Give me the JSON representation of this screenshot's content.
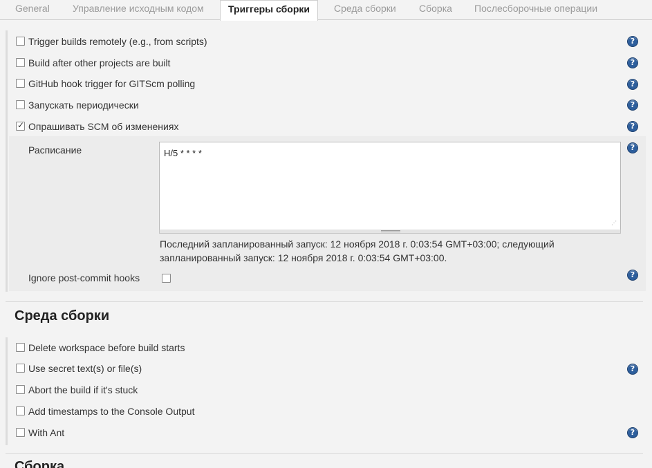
{
  "tabs": [
    {
      "label": "General",
      "active": false
    },
    {
      "label": "Управление исходным кодом",
      "active": false
    },
    {
      "label": "Триггеры сборки",
      "active": true
    },
    {
      "label": "Среда сборки",
      "active": false
    },
    {
      "label": "Сборка",
      "active": false
    },
    {
      "label": "Послесборочные операции",
      "active": false
    }
  ],
  "triggers": {
    "items": [
      {
        "label": "Trigger builds remotely (e.g., from scripts)",
        "checked": false
      },
      {
        "label": "Build after other projects are built",
        "checked": false
      },
      {
        "label": "GitHub hook trigger for GITScm polling",
        "checked": false
      },
      {
        "label": "Запускать периодически",
        "checked": false
      },
      {
        "label": "Опрашивать SCM об изменениях",
        "checked": true
      }
    ],
    "schedule": {
      "label": "Расписание",
      "value": "H/5 * * * *",
      "info": "Последний запланированный запуск: 12 ноября 2018 г. 0:03:54 GMT+03:00; следующий запланированный запуск: 12 ноября 2018 г. 0:03:54 GMT+03:00."
    },
    "ignore_hooks": {
      "label": "Ignore post-commit hooks",
      "checked": false
    }
  },
  "build_env": {
    "title": "Среда сборки",
    "items": [
      {
        "label": "Delete workspace before build starts",
        "checked": false
      },
      {
        "label": "Use secret text(s) or file(s)",
        "checked": false
      },
      {
        "label": "Abort the build if it's stuck",
        "checked": false
      },
      {
        "label": "Add timestamps to the Console Output",
        "checked": false
      },
      {
        "label": "With Ant",
        "checked": false
      }
    ]
  },
  "build": {
    "title": "Сборка"
  },
  "help_glyph": "?",
  "colors": {
    "help": "#2d5e9c",
    "background": "#f3f3f3"
  }
}
